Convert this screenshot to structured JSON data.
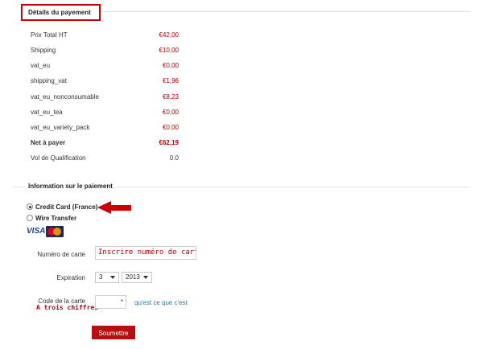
{
  "payment_details": {
    "title": "Détails du payement",
    "rows": [
      {
        "label": "Prix Total HT",
        "value": "€42,00"
      },
      {
        "label": "Shipping",
        "value": "€10,00"
      },
      {
        "label": "vat_eu",
        "value": "€0,00"
      },
      {
        "label": "shipping_vat",
        "value": "€1,96"
      },
      {
        "label": "vat_eu_nonconsumable",
        "value": "€8,23"
      },
      {
        "label": "vat_eu_tea",
        "value": "€0,00"
      },
      {
        "label": "vat_eu_variety_pack",
        "value": "€0,00"
      },
      {
        "label": "Net à payer",
        "value": "€62,19"
      },
      {
        "label": "Vol de Qualification",
        "value": "0.0"
      }
    ]
  },
  "payment_info": {
    "title": "Information sur le paiement",
    "methods": [
      {
        "label": "Credit Card (France)",
        "selected": true
      },
      {
        "label": "Wire Transfer",
        "selected": false
      }
    ],
    "card_logos": [
      "VISA",
      "MasterCard"
    ]
  },
  "form": {
    "card_number_label": "Numéro de carte",
    "card_number_value": "Inscrire numéro de carte",
    "expiration_label": "Expiration",
    "exp_month": "3",
    "exp_year": "2013",
    "cvv_label": "Code de la carte",
    "cvv_required_marker": "*",
    "cvv_help_link": "qu'est ce que c'est",
    "cvv_annotation": "A trois chiffres",
    "submit_label": "Soumettre"
  },
  "colors": {
    "accent": "#cc0000",
    "value_red": "#b30000",
    "link": "#2b7a9a",
    "button": "#b70f0f"
  }
}
